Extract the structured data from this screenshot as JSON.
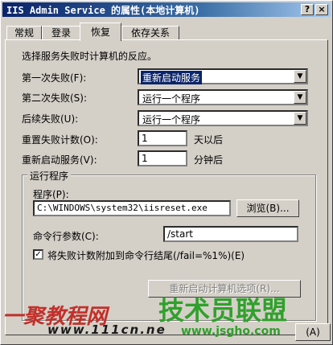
{
  "window": {
    "title": "IIS Admin Service 的属性(本地计算机)",
    "help_button": "?",
    "close_button": "×"
  },
  "tabs": [
    {
      "label": "常规"
    },
    {
      "label": "登录"
    },
    {
      "label": "恢复",
      "active": true
    },
    {
      "label": "依存关系"
    }
  ],
  "recovery": {
    "intro": "选择服务失败时计算机的反应。",
    "first_failure_label": "第一次失败(F):",
    "first_failure_value": "重新启动服务",
    "second_failure_label": "第二次失败(S):",
    "second_failure_value": "运行一个程序",
    "subsequent_failure_label": "后续失败(U):",
    "subsequent_failure_value": "运行一个程序",
    "reset_count_label": "重置失败计数(O):",
    "reset_count_value": "1",
    "reset_count_unit": "天以后",
    "restart_service_label": "重新启动服务(V):",
    "restart_service_value": "1",
    "restart_service_unit": "分钟后"
  },
  "run_program": {
    "group_title": "运行程序",
    "program_label": "程序(P):",
    "program_value": "C:\\WINDOWS\\system32\\iisreset.exe",
    "browse_button": "浏览(B)...",
    "params_label": "命令行参数(C):",
    "params_value": "/start",
    "append_checkbox_label": "将失败计数附加到命令行结尾(/fail=%1%)(E)",
    "append_checked": true
  },
  "restart_options_button": "重新启动计算机选项(R)...",
  "footer_button": "(A)",
  "watermark": {
    "brand_cn": "一聚教程网",
    "brand_url": "www.111cn.ne",
    "forum_cn": "技术员联盟",
    "forum_url": "www.jsgho.com"
  },
  "colors": {
    "face": "#d4d0c8",
    "title_start": "#0a246a",
    "title_end": "#a6caf0",
    "selection": "#0a246a"
  }
}
